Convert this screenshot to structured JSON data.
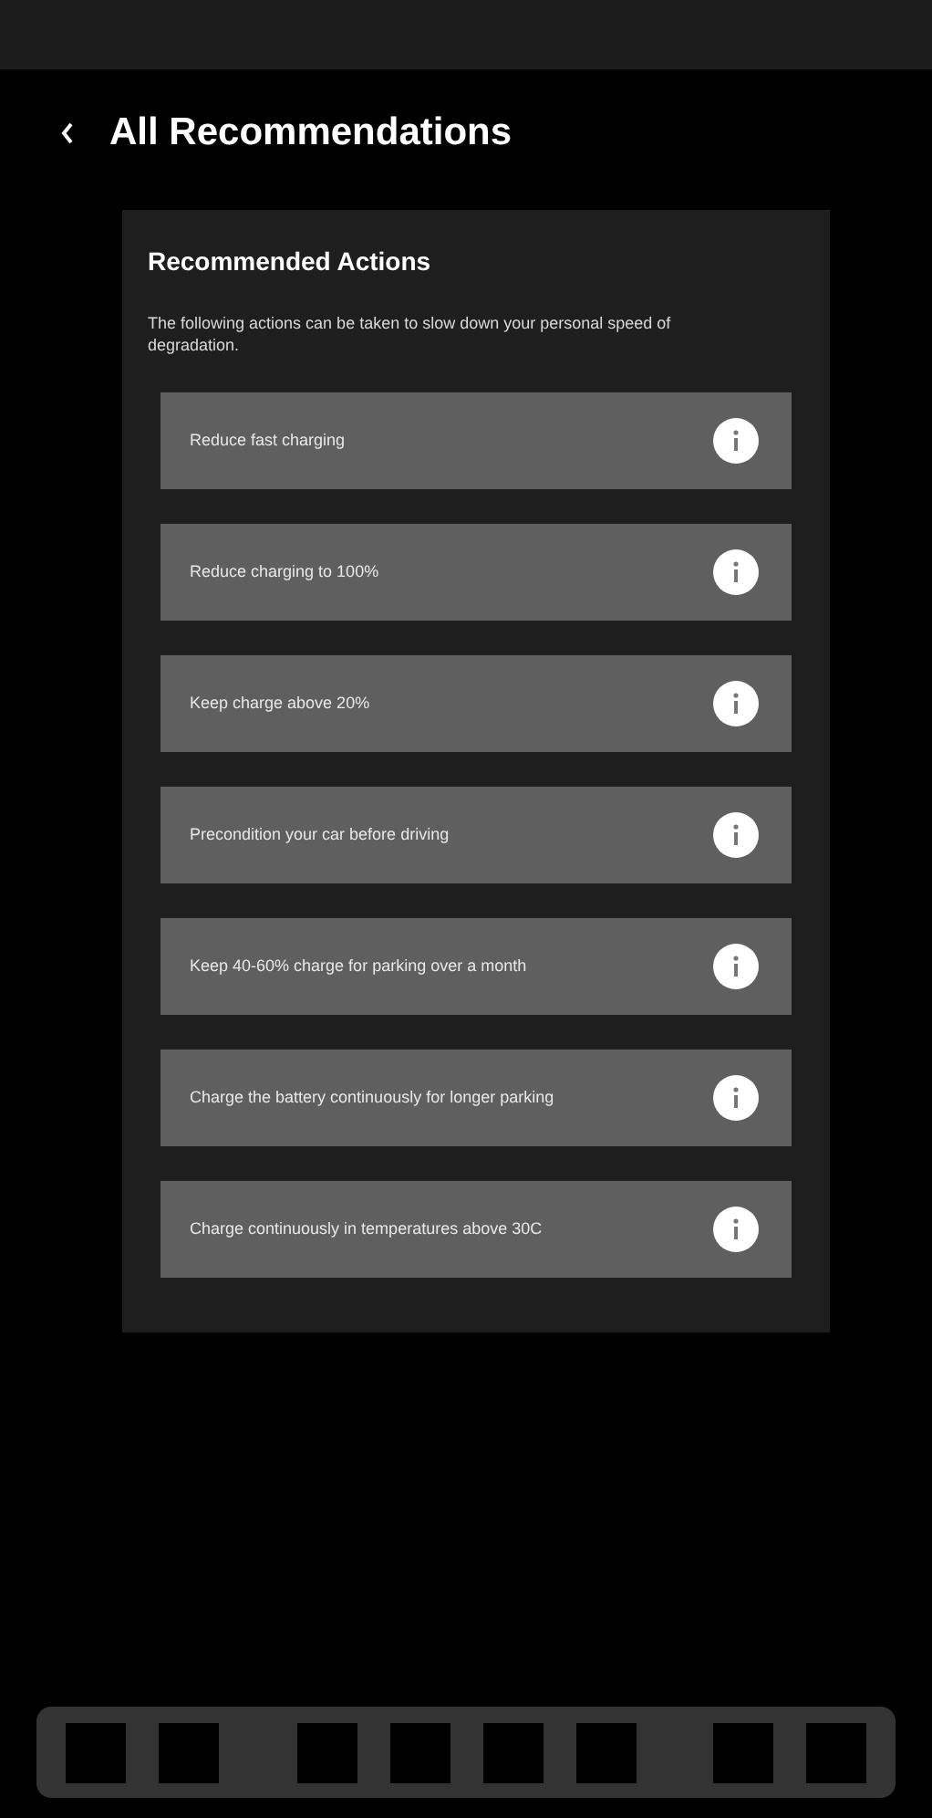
{
  "header": {
    "title": "All Recommendations"
  },
  "card": {
    "title": "Recommended Actions",
    "description": "The following actions can be taken to slow down your personal speed of degradation.",
    "actions": [
      {
        "label": "Reduce fast charging"
      },
      {
        "label": "Reduce charging to 100%"
      },
      {
        "label": "Keep charge above 20%"
      },
      {
        "label": "Precondition your car before driving"
      },
      {
        "label": "Keep 40-60% charge for parking over a month"
      },
      {
        "label": "Charge the battery continuously for longer parking"
      },
      {
        "label": "Charge continuously in temperatures above 30C"
      }
    ]
  }
}
